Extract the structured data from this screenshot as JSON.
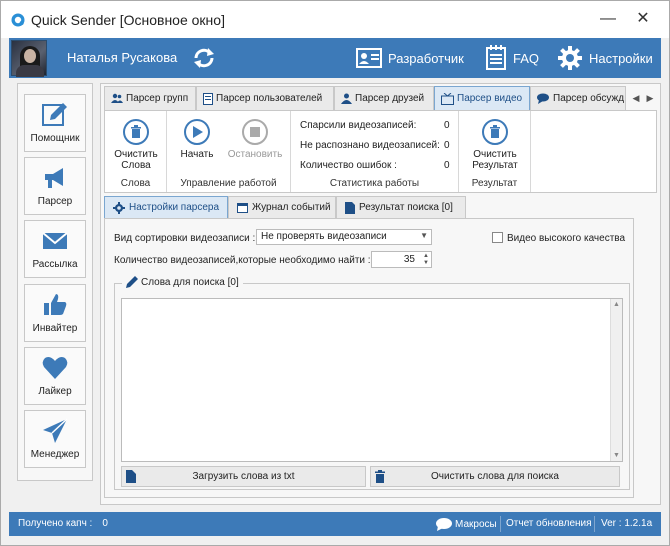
{
  "window": {
    "title": "Quick Sender [Основное окно]",
    "minimize": "—",
    "close": "✕"
  },
  "header": {
    "user_name": "Наталья Русакова",
    "developer_label": "Разработчик",
    "faq_label": "FAQ",
    "settings_label": "Настройки"
  },
  "sidebar": {
    "items": [
      {
        "label": "Помощник",
        "icon": "pencil-icon"
      },
      {
        "label": "Парсер",
        "icon": "megaphone-icon"
      },
      {
        "label": "Рассылка",
        "icon": "envelope-icon"
      },
      {
        "label": "Инвайтер",
        "icon": "thumbs-up-icon"
      },
      {
        "label": "Лайкер",
        "icon": "heart-icon"
      },
      {
        "label": "Менеджер",
        "icon": "paper-plane-icon"
      }
    ]
  },
  "parser_tabs": [
    {
      "label": "Парсер групп"
    },
    {
      "label": "Парсер пользователей"
    },
    {
      "label": "Парсер друзей"
    },
    {
      "label": "Парсер видео"
    },
    {
      "label": "Парсер обсужд"
    }
  ],
  "ribbon": {
    "words_group": {
      "title": "Слова",
      "clear_label_1": "Очистить",
      "clear_label_2": "Слова"
    },
    "control_group": {
      "title": "Управление работой",
      "start_label": "Начать",
      "stop_label": "Остановить"
    },
    "stats_group": {
      "title": "Статистика работы",
      "parsed_label": "Спарсили видеозаписей:",
      "parsed_value": "0",
      "unrecognized_label": "Не распознано видеозаписей:",
      "unrecognized_value": "0",
      "errors_label": "Количество ошибок :",
      "errors_value": "0"
    },
    "result_group": {
      "title": "Результат",
      "clear_label_1": "Очистить",
      "clear_label_2": "Результат"
    }
  },
  "sub_tabs": [
    {
      "label": "Настройки парсера"
    },
    {
      "label": "Журнал событий"
    },
    {
      "label": "Результат поиска [0]"
    }
  ],
  "settings": {
    "sort_label": "Вид сортировки видеозаписи :",
    "sort_value": "Не проверять видеозаписи",
    "hq_label": "Видео высокого качества",
    "count_label": "Количество видеозаписей,которые необходимо найти :",
    "count_value": "35",
    "search_words_title": "Слова для поиска [0]",
    "load_words_label": "Загрузить слова из txt",
    "clear_words_label": "Очистить слова для поиска"
  },
  "statusbar": {
    "captcha_label": "Получено капч :",
    "captcha_value": "0",
    "macros_label": "Макросы",
    "report_label": "Отчет обновления",
    "version_label": "Ver : 1.2.1a"
  },
  "colors": {
    "accent": "#3d7ab8",
    "tab_active_bg": "#dbe8f5",
    "tab_active_text": "#1e4f87"
  }
}
